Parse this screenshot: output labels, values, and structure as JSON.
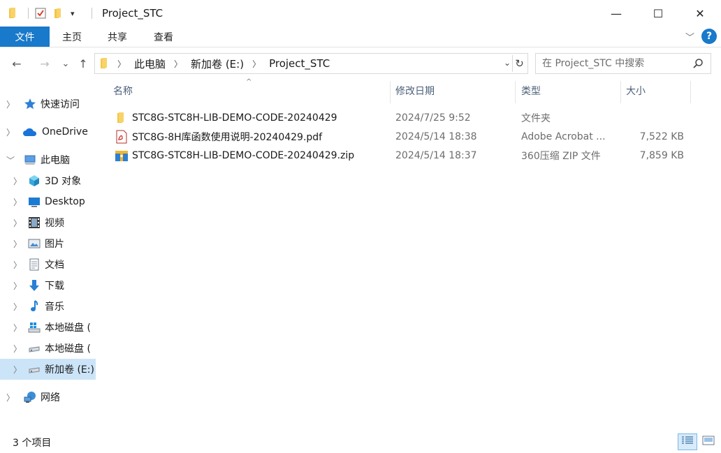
{
  "window": {
    "title": "Project_STC",
    "minimize": "—",
    "maximize": "☐",
    "close": "✕"
  },
  "ribbon": {
    "tabs": [
      {
        "label": "文件"
      },
      {
        "label": "主页"
      },
      {
        "label": "共享"
      },
      {
        "label": "查看"
      }
    ],
    "expand": "﹀",
    "help": "?"
  },
  "nav": {
    "back": "←",
    "forward": "→",
    "recent": "⌄",
    "up": "↑"
  },
  "address": {
    "crumbs": [
      {
        "label": "此电脑"
      },
      {
        "label": "新加卷 (E:)"
      },
      {
        "label": "Project_STC"
      }
    ],
    "separator": "〉",
    "dropdown": "⌄",
    "refresh": "↻"
  },
  "search": {
    "placeholder": "在 Project_STC 中搜索"
  },
  "sidebar": {
    "items": [
      {
        "label": "快速访问",
        "icon": "star-icon",
        "expander": "〉"
      },
      {
        "label": "OneDrive",
        "icon": "cloud-icon",
        "expander": "〉"
      },
      {
        "label": "此电脑",
        "icon": "computer-icon",
        "expander": "﹀"
      },
      {
        "label": "3D 对象",
        "icon": "cube-icon",
        "expander": "〉"
      },
      {
        "label": "Desktop",
        "icon": "desktop-icon",
        "expander": "〉"
      },
      {
        "label": "视频",
        "icon": "film-icon",
        "expander": "〉"
      },
      {
        "label": "图片",
        "icon": "picture-icon",
        "expander": "〉"
      },
      {
        "label": "文档",
        "icon": "document-icon",
        "expander": "〉"
      },
      {
        "label": "下载",
        "icon": "download-icon",
        "expander": "〉"
      },
      {
        "label": "音乐",
        "icon": "music-icon",
        "expander": "〉"
      },
      {
        "label": "本地磁盘 (",
        "icon": "windows-drive-icon",
        "expander": "〉"
      },
      {
        "label": "本地磁盘 (",
        "icon": "drive-icon",
        "expander": "〉"
      },
      {
        "label": "新加卷 (E:)",
        "icon": "drive-icon",
        "expander": "〉"
      },
      {
        "label": "网络",
        "icon": "network-icon",
        "expander": "〉"
      }
    ]
  },
  "columns": {
    "name": "名称",
    "date": "修改日期",
    "type": "类型",
    "size": "大小",
    "sort_indicator": "^"
  },
  "files": [
    {
      "name": "STC8G-STC8H-LIB-DEMO-CODE-20240429",
      "date": "2024/7/25 9:52",
      "type": "文件夹",
      "size": "",
      "icon": "folder-icon"
    },
    {
      "name": "STC8G-8H库函数使用说明-20240429.pdf",
      "date": "2024/5/14 18:38",
      "type": "Adobe Acrobat ...",
      "size": "7,522 KB",
      "icon": "pdf-icon"
    },
    {
      "name": "STC8G-STC8H-LIB-DEMO-CODE-20240429.zip",
      "date": "2024/5/14 18:37",
      "type": "360压缩 ZIP 文件",
      "size": "7,859 KB",
      "icon": "zip-icon"
    }
  ],
  "status": {
    "count": "3 个项目"
  },
  "colors": {
    "accent": "#1979ca",
    "selected": "#cce4f7",
    "folder": "#f5c542"
  }
}
